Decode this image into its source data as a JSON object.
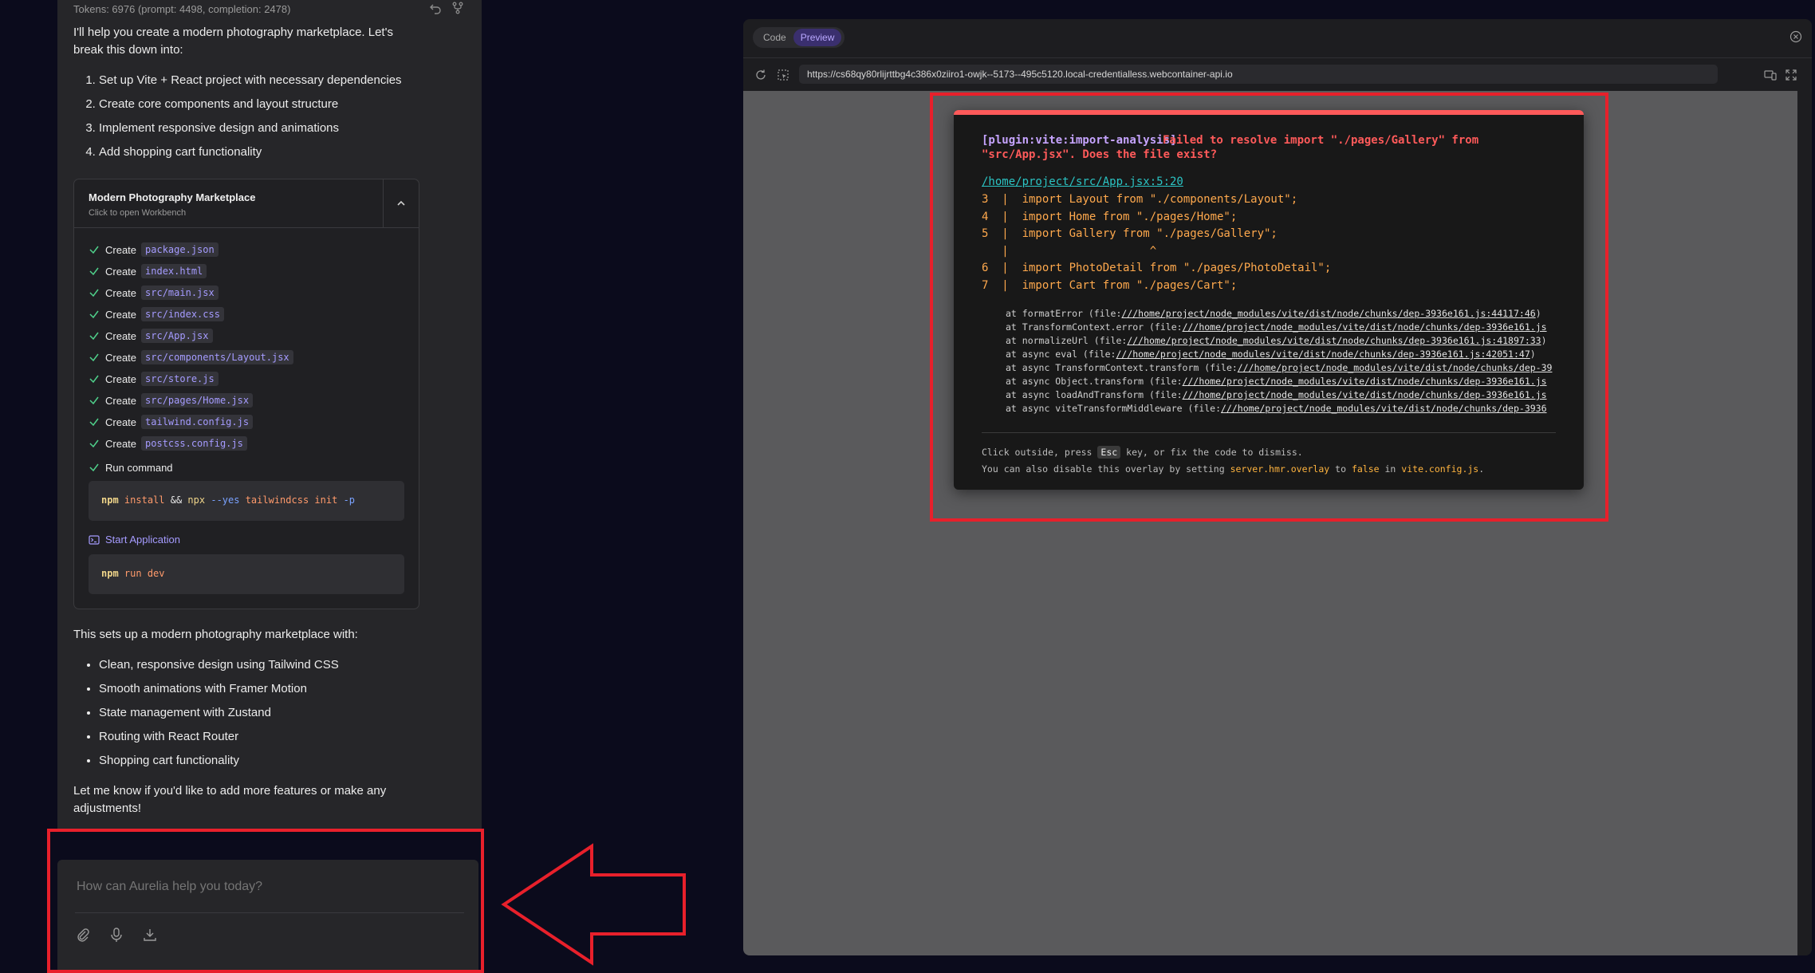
{
  "chat": {
    "tokens": "Tokens: 6976 (prompt: 4498, completion: 2478)",
    "intro_line1": "I'll help you create a modern photography marketplace. Let's",
    "intro_line2": "break this down into:",
    "steps": [
      "Set up Vite + React project with necessary dependencies",
      "Create core components and layout structure",
      "Implement responsive design and animations",
      "Add shopping cart functionality"
    ],
    "artifact": {
      "title": "Modern Photography Marketplace",
      "subtitle": "Click to open Workbench",
      "actions": [
        {
          "verb": "Create",
          "file": "package.json"
        },
        {
          "verb": "Create",
          "file": "index.html"
        },
        {
          "verb": "Create",
          "file": "src/main.jsx"
        },
        {
          "verb": "Create",
          "file": "src/index.css"
        },
        {
          "verb": "Create",
          "file": "src/App.jsx"
        },
        {
          "verb": "Create",
          "file": "src/components/Layout.jsx"
        },
        {
          "verb": "Create",
          "file": "src/store.js"
        },
        {
          "verb": "Create",
          "file": "src/pages/Home.jsx"
        },
        {
          "verb": "Create",
          "file": "tailwind.config.js"
        },
        {
          "verb": "Create",
          "file": "postcss.config.js"
        }
      ],
      "run_command_label": "Run command",
      "install_cmd": {
        "npm": "npm",
        "a": "install",
        "and": "&&",
        "npx": "npx",
        "yes": "--yes",
        "pkg": "tailwindcss",
        "init": "init",
        "p": "-p"
      },
      "start_label": "Start Application",
      "dev_cmd": {
        "npm": "npm",
        "rest": "run dev"
      }
    },
    "summary_intro": "This sets up a modern photography marketplace with:",
    "features": [
      "Clean, responsive design using Tailwind CSS",
      "Smooth animations with Framer Motion",
      "State management with Zustand",
      "Routing with React Router",
      "Shopping cart functionality"
    ],
    "closing_line1": "Let me know if you'd like to add more features or make any",
    "closing_line2": "adjustments!",
    "prompt_placeholder": "How can Aurelia help you today?"
  },
  "preview": {
    "tabs": [
      "Code",
      "Preview"
    ],
    "active_tab": "Preview",
    "url": "https://cs68qy80rlijrttbg4c386x0ziiro1-owjk--5173--495c5120.local-credentialless.webcontainer-api.io",
    "error": {
      "plugin": "[plugin:vite:import-analysis]",
      "message_a": "Failed to resolve import \"./pages/Gallery\" from",
      "message_b": "\"src/App.jsx\". Does the file exist?",
      "file": "/home/project/src/App.jsx:5:20",
      "frames": [
        "3  |  import Layout from \"./components/Layout\";",
        "4  |  import Home from \"./pages/Home\";",
        "5  |  import Gallery from \"./pages/Gallery\";",
        "   |                     ^",
        "6  |  import PhotoDetail from \"./pages/PhotoDetail\";",
        "7  |  import Cart from \"./pages/Cart\";"
      ],
      "stack": [
        {
          "pre": "at formatError (file:",
          "link": "///home/project/node_modules/vite/dist/node/chunks/dep-3936e161.js:44117:46",
          "post": ")"
        },
        {
          "pre": "at TransformContext.error (file:",
          "link": "///home/project/node_modules/vite/dist/node/chunks/dep-3936e161.js",
          "post": ""
        },
        {
          "pre": "at normalizeUrl (file:",
          "link": "///home/project/node_modules/vite/dist/node/chunks/dep-3936e161.js:41897:33",
          "post": ")"
        },
        {
          "pre": "at async eval (file:",
          "link": "///home/project/node_modules/vite/dist/node/chunks/dep-3936e161.js:42051:47",
          "post": ")"
        },
        {
          "pre": "at async TransformContext.transform (file:",
          "link": "///home/project/node_modules/vite/dist/node/chunks/dep-39",
          "post": ""
        },
        {
          "pre": "at async Object.transform (file:",
          "link": "///home/project/node_modules/vite/dist/node/chunks/dep-3936e161.js",
          "post": ""
        },
        {
          "pre": "at async loadAndTransform (file:",
          "link": "///home/project/node_modules/vite/dist/node/chunks/dep-3936e161.js",
          "post": ""
        },
        {
          "pre": "at async viteTransformMiddleware (file:",
          "link": "///home/project/node_modules/vite/dist/node/chunks/dep-3936",
          "post": ""
        }
      ],
      "tip1_a": "Click outside, press",
      "tip1_key": "Esc",
      "tip1_b": "key, or fix the code to dismiss.",
      "tip2_a": "You can also disable this overlay by setting",
      "tip2_setting": "server.hmr.overlay",
      "tip2_to": "to",
      "tip2_false": "false",
      "tip2_in": "in",
      "tip2_file": "vite.config.js",
      "tip2_end": "."
    }
  },
  "colors": {
    "accent": "#a59bff",
    "error": "#ff5a5a",
    "annotation": "#e8202b"
  }
}
